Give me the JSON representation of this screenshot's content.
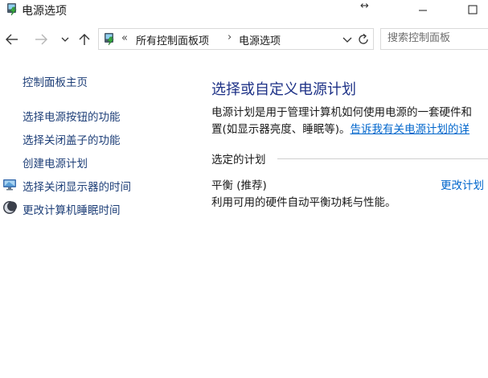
{
  "window": {
    "title": "电源选项",
    "resize_glyph": "↔"
  },
  "nav": {
    "back_icon": "arrow-left-icon",
    "forward_icon": "arrow-right-icon",
    "recent_icon": "chevron-down-icon",
    "up_icon": "arrow-up-icon"
  },
  "address": {
    "overflow": "«",
    "crumbs": [
      "所有控制面板项",
      "电源选项"
    ],
    "separator": "›"
  },
  "search": {
    "placeholder": "搜索控制面板"
  },
  "sidebar": {
    "home": "控制面板主页",
    "items": [
      "选择电源按钮的功能",
      "选择关闭盖子的功能",
      "创建电源计划",
      "选择关闭显示器的时间",
      "更改计算机睡眠时间"
    ]
  },
  "main": {
    "heading": "选择或自定义电源计划",
    "description_line1": "电源计划是用于管理计算机如何使用电源的一套硬件和",
    "description_line2": "置(如显示器亮度、睡眠等)。",
    "description_link": "告诉我有关电源计划的详",
    "section_label": "选定的计划",
    "plan_name": "平衡 (推荐)",
    "plan_change": "更改计划",
    "plan_description": "利用可用的硬件自动平衡功耗与性能。"
  },
  "colors": {
    "link": "#1e3f78",
    "heading": "#1e3287",
    "hyperlink": "#0066cc"
  }
}
